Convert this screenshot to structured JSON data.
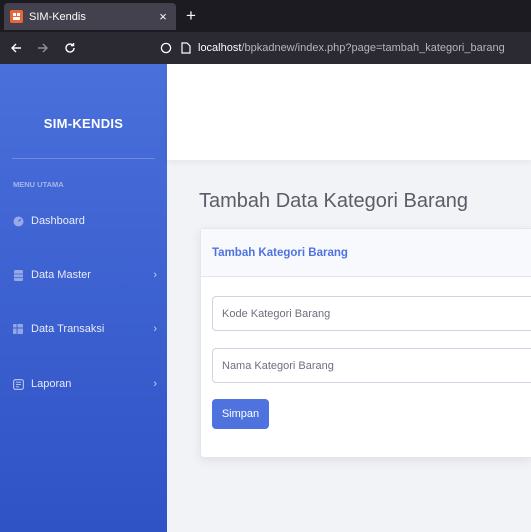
{
  "browser": {
    "tab_title": "SIM-Kendis",
    "tab_close": "×",
    "new_tab": "+",
    "url_host": "localhost",
    "url_path": "/bpkadnew/index.php?page=tambah_kategori_barang"
  },
  "sidebar": {
    "brand": "SIM-KENDIS",
    "heading": "MENU UTAMA",
    "items": [
      {
        "label": "Dashboard",
        "icon": "gauge-icon",
        "has_submenu": false
      },
      {
        "label": "Data Master",
        "icon": "database-icon",
        "has_submenu": true
      },
      {
        "label": "Data Transaksi",
        "icon": "table-icon",
        "has_submenu": true
      },
      {
        "label": "Laporan",
        "icon": "report-icon",
        "has_submenu": true
      }
    ],
    "chevron": "›"
  },
  "main": {
    "page_title": "Tambah Data Kategori Barang",
    "card_title": "Tambah Kategori Barang",
    "fields": [
      {
        "placeholder": "Kode Kategori Barang",
        "value": ""
      },
      {
        "placeholder": "Nama Kategori Barang",
        "value": ""
      }
    ],
    "submit_label": "Simpan"
  },
  "colors": {
    "sidebar_gradient_top": "#4a70db",
    "sidebar_gradient_bottom": "#2f52c5",
    "primary": "#4e73df",
    "page_bg": "#f2f3f7",
    "title_text": "#5a5c69"
  }
}
